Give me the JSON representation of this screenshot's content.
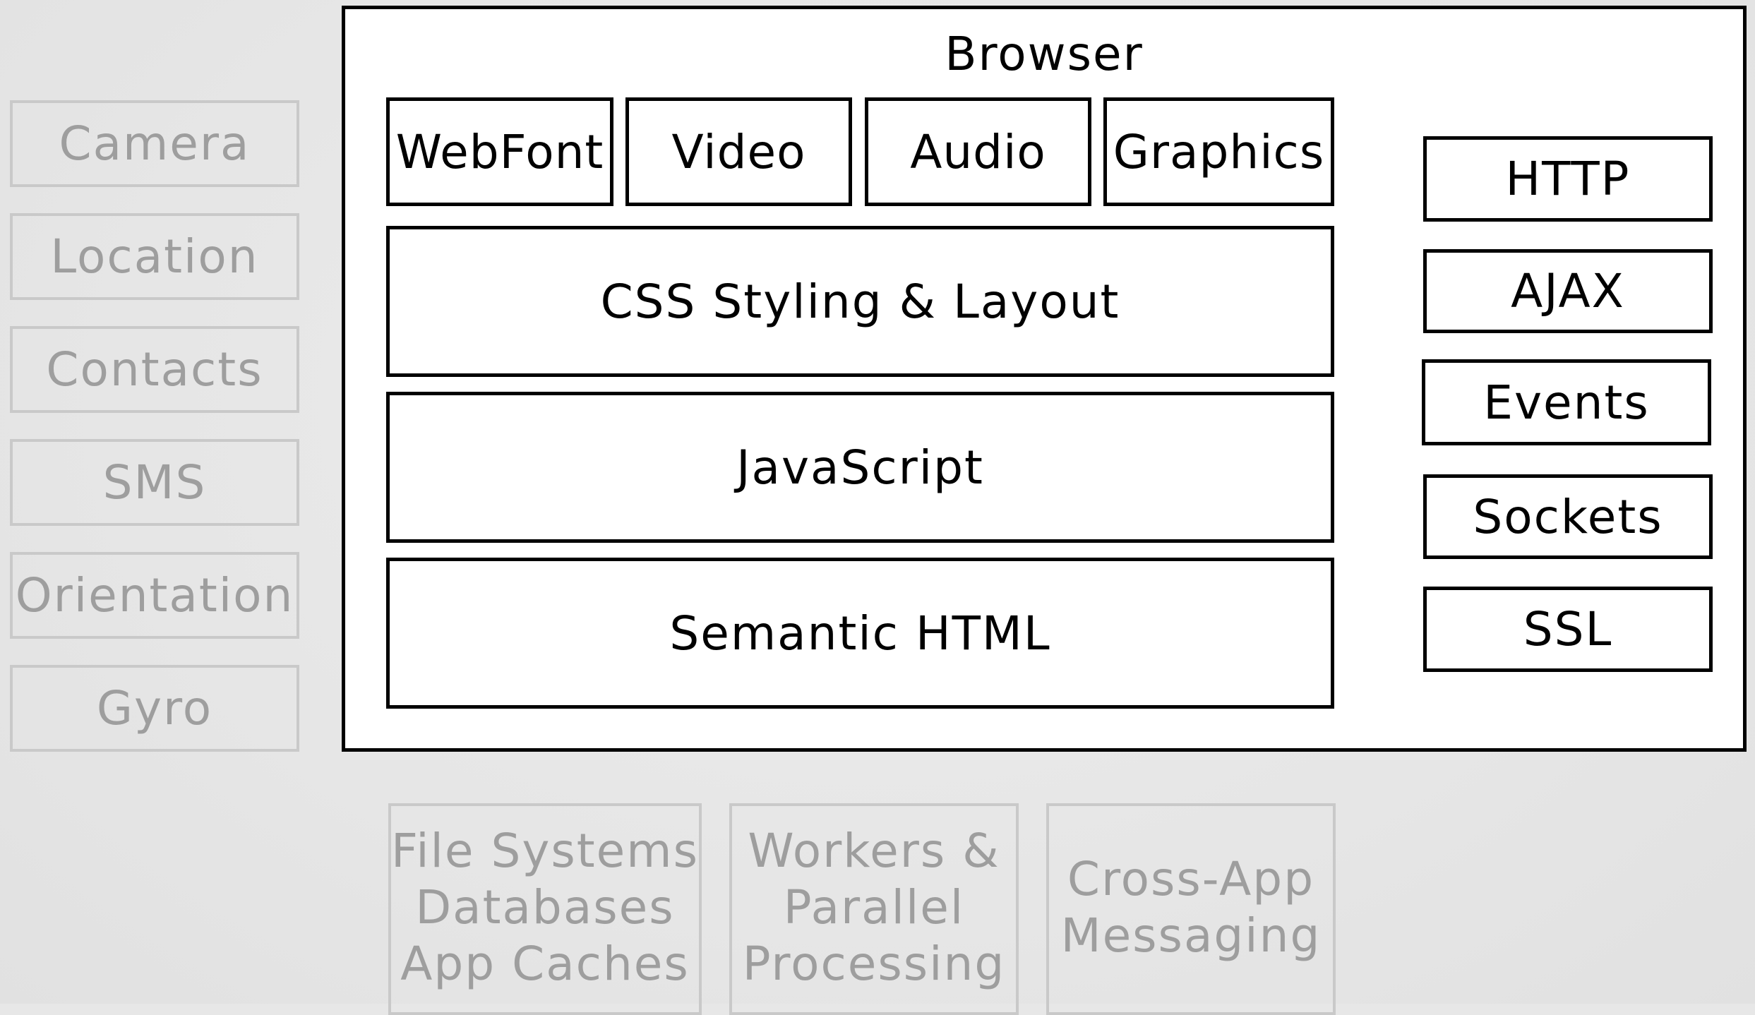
{
  "device_features": [
    "Camera",
    "Location",
    "Contacts",
    "SMS",
    "Orientation",
    "Gyro"
  ],
  "browser": {
    "title": "Browser",
    "media": [
      "WebFont",
      "Video",
      "Audio",
      "Graphics"
    ],
    "layers": {
      "css": "CSS Styling & Layout",
      "js": "JavaScript",
      "html": "Semantic HTML"
    },
    "network": [
      "HTTP",
      "AJAX",
      "Events",
      "Sockets",
      "SSL"
    ]
  },
  "storage": {
    "box1": [
      "File Systems",
      "Databases",
      "App Caches"
    ],
    "box2": [
      "Workers &",
      "Parallel",
      "Processing"
    ],
    "box3": [
      "Cross-App",
      "Messaging"
    ]
  }
}
